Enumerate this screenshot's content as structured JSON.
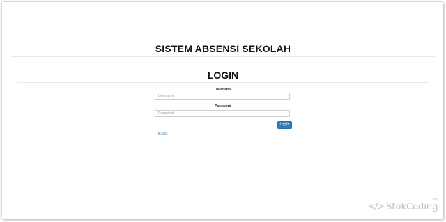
{
  "app": {
    "title": "SISTEM ABSENSI SEKOLAH"
  },
  "login": {
    "heading": "LOGIN",
    "username_label": "Username",
    "username_placeholder": "Username",
    "password_label": "Password",
    "password_placeholder": "Password",
    "submit_label": "Log In",
    "back_label": "BACK"
  },
  "watermark": {
    "icon": "code-brackets-icon",
    "text": "StokCoding",
    "suffix": ".com"
  },
  "colors": {
    "primary": "#337ab7",
    "divider": "#e8e8e8",
    "text": "#111111"
  }
}
